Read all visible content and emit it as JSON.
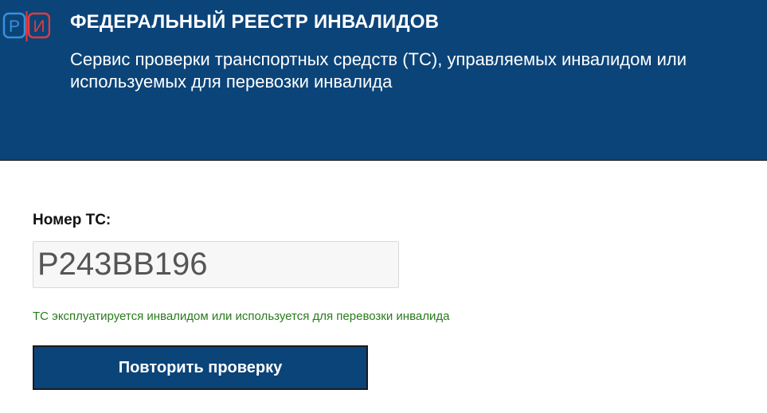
{
  "header": {
    "logo_text": "РИ",
    "title": "ФЕДЕРАЛЬНЫЙ РЕЕСТР ИНВАЛИДОВ",
    "subtitle": "Сервис проверки транспортных средств (ТС), управляемых инвалидом или используемых для перевозки инвалида"
  },
  "form": {
    "plate_label": "Номер ТС:",
    "plate_value": "Р243ВВ196",
    "status_message": "ТС эксплуатируется инвалидом или используется для перевозки инвалида",
    "retry_label": "Повторить проверку"
  },
  "colors": {
    "header_bg": "#0b4479",
    "logo_blue": "#3b8fd9",
    "logo_red": "#e23b3b",
    "status_green": "#2a7a1e"
  }
}
